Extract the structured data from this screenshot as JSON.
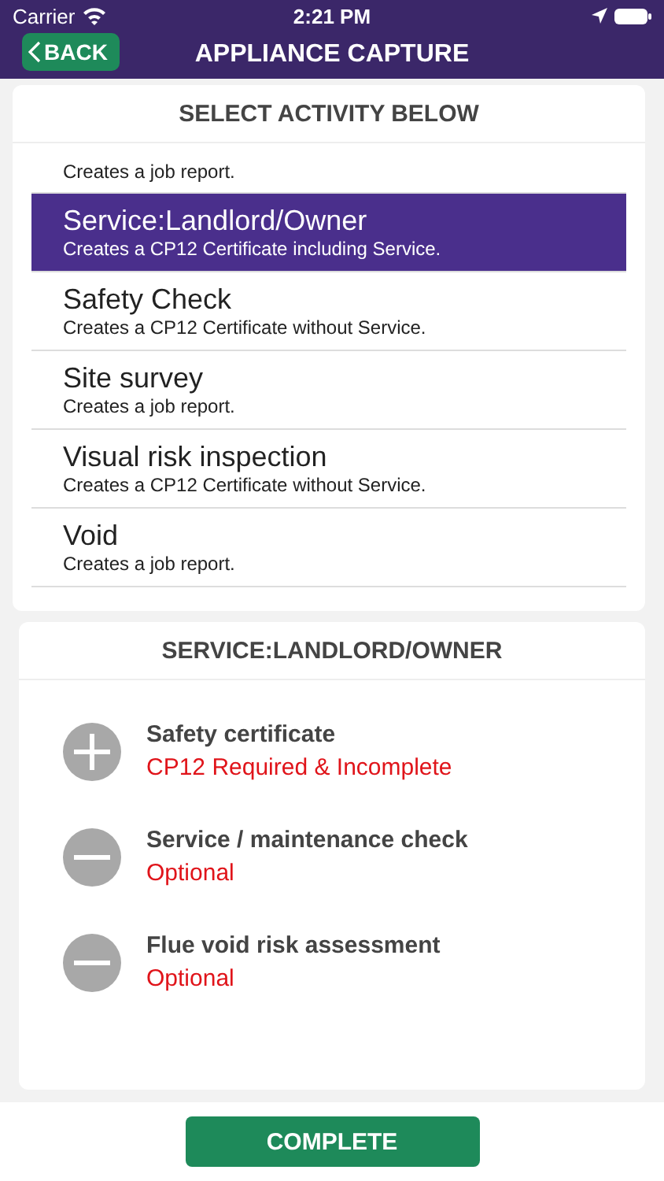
{
  "status_bar": {
    "carrier": "Carrier",
    "time": "2:21 PM"
  },
  "header": {
    "back": "BACK",
    "title": "APPLIANCE CAPTURE"
  },
  "activities": {
    "title": "SELECT ACTIVITY BELOW",
    "items": [
      {
        "description": "Creates a job report.",
        "selected": false
      },
      {
        "name": "Service:Landlord/Owner",
        "description": "Creates a CP12 Certificate including Service.",
        "selected": true
      },
      {
        "name": "Safety Check",
        "description": "Creates a CP12 Certificate without Service.",
        "selected": false
      },
      {
        "name": "Site survey",
        "description": "Creates a job report.",
        "selected": false
      },
      {
        "name": "Visual risk inspection",
        "description": "Creates a CP12 Certificate without Service.",
        "selected": false
      },
      {
        "name": "Void",
        "description": "Creates a job report.",
        "selected": false
      }
    ]
  },
  "tasks": {
    "title": "SERVICE:LANDLORD/OWNER",
    "items": [
      {
        "kind": "add",
        "name": "Safety certificate",
        "status": "CP12 Required & Incomplete"
      },
      {
        "kind": "remove",
        "name": "Service / maintenance check",
        "status": "Optional"
      },
      {
        "kind": "remove",
        "name": "Flue void risk assessment",
        "status": "Optional"
      }
    ]
  },
  "footer": {
    "button": "COMPLETE"
  }
}
